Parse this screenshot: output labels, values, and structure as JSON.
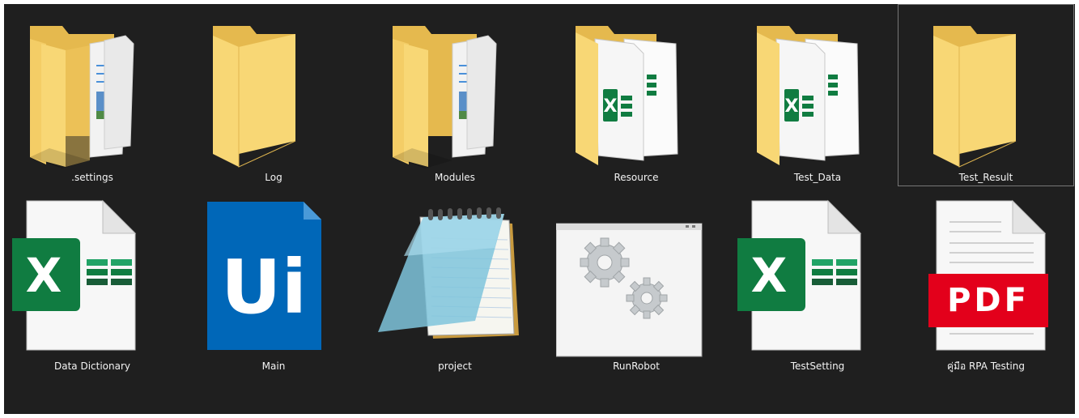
{
  "files": [
    {
      "name": ".settings",
      "icon": "folder-with-documents-icon",
      "selected": false
    },
    {
      "name": "Log",
      "icon": "folder-icon",
      "selected": false
    },
    {
      "name": "Modules",
      "icon": "folder-with-documents-icon",
      "selected": false
    },
    {
      "name": "Resource",
      "icon": "folder-with-spreadsheets-icon",
      "selected": false
    },
    {
      "name": "Test_Data",
      "icon": "folder-with-spreadsheets-icon",
      "selected": false
    },
    {
      "name": "Test_Result",
      "icon": "folder-icon",
      "selected": true
    },
    {
      "name": "Data Dictionary",
      "icon": "excel-file-icon",
      "icon_text": "X",
      "selected": false
    },
    {
      "name": "Main",
      "icon": "uipath-file-icon",
      "icon_text": "Ui",
      "selected": false
    },
    {
      "name": "project",
      "icon": "notepad-file-icon",
      "selected": false
    },
    {
      "name": "RunRobot",
      "icon": "executable-gears-icon",
      "selected": false
    },
    {
      "name": "TestSetting",
      "icon": "excel-file-icon",
      "icon_text": "X",
      "selected": false
    },
    {
      "name": "คู่มือ RPA Testing",
      "icon": "pdf-file-icon",
      "icon_text": "PDF",
      "selected": false
    }
  ],
  "colors": {
    "background": "#1f1f1f",
    "label_text": "#f3f3f3",
    "folder_yellow": "#f8d775",
    "excel_green": "#107c41",
    "uipath_blue": "#0067b8",
    "pdf_red": "#e3001b"
  }
}
